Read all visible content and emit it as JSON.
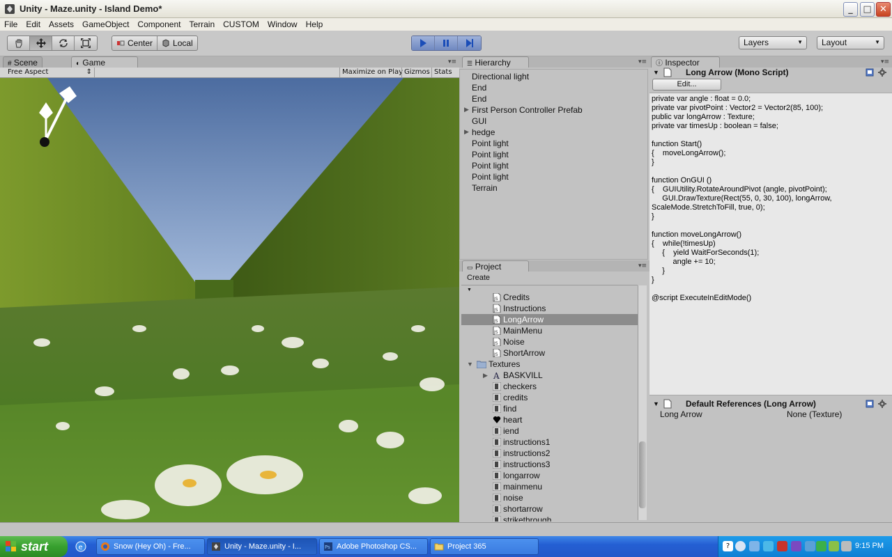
{
  "window": {
    "title": "Unity - Maze.unity - Island Demo*"
  },
  "menu": [
    "File",
    "Edit",
    "Assets",
    "GameObject",
    "Component",
    "Terrain",
    "CUSTOM",
    "Window",
    "Help"
  ],
  "toolbar": {
    "pivot_center": "Center",
    "pivot_local": "Local",
    "layers": "Layers",
    "layout": "Layout"
  },
  "game_view": {
    "tabs": [
      "Scene",
      "Game"
    ],
    "aspect": "Free Aspect",
    "maximize_on_play": "Maximize on Play",
    "gizmos": "Gizmos",
    "stats": "Stats"
  },
  "hierarchy": {
    "tab": "Hierarchy",
    "items": [
      {
        "label": "Directional light",
        "expandable": false
      },
      {
        "label": "End",
        "expandable": false
      },
      {
        "label": "End",
        "expandable": false
      },
      {
        "label": "First Person Controller Prefab",
        "expandable": true
      },
      {
        "label": "GUI",
        "expandable": false
      },
      {
        "label": "hedge",
        "expandable": true
      },
      {
        "label": "Point light",
        "expandable": false
      },
      {
        "label": "Point light",
        "expandable": false
      },
      {
        "label": "Point light",
        "expandable": false
      },
      {
        "label": "Point light",
        "expandable": false
      },
      {
        "label": "Terrain",
        "expandable": false
      }
    ]
  },
  "project": {
    "tab": "Project",
    "create": "Create",
    "items": [
      {
        "label": "Credits",
        "type": "script",
        "indent": 2
      },
      {
        "label": "Instructions",
        "type": "script",
        "indent": 2
      },
      {
        "label": "LongArrow",
        "type": "script",
        "indent": 2,
        "selected": true
      },
      {
        "label": "MainMenu",
        "type": "script",
        "indent": 2
      },
      {
        "label": "Noise",
        "type": "script",
        "indent": 2
      },
      {
        "label": "ShortArrow",
        "type": "script",
        "indent": 2
      },
      {
        "label": "Textures",
        "type": "folder",
        "indent": 1
      },
      {
        "label": "BASKVILL",
        "type": "font",
        "indent": 2
      },
      {
        "label": "checkers",
        "type": "texture",
        "indent": 2
      },
      {
        "label": "credits",
        "type": "texture",
        "indent": 2
      },
      {
        "label": "find",
        "type": "texture",
        "indent": 2
      },
      {
        "label": "heart",
        "type": "heart",
        "indent": 2
      },
      {
        "label": "iend",
        "type": "texture",
        "indent": 2
      },
      {
        "label": "instructions1",
        "type": "texture",
        "indent": 2
      },
      {
        "label": "instructions2",
        "type": "texture",
        "indent": 2
      },
      {
        "label": "instructions3",
        "type": "texture",
        "indent": 2
      },
      {
        "label": "longarrow",
        "type": "texture",
        "indent": 2
      },
      {
        "label": "mainmenu",
        "type": "texture",
        "indent": 2
      },
      {
        "label": "noise",
        "type": "texture",
        "indent": 2
      },
      {
        "label": "shortarrow",
        "type": "texture",
        "indent": 2
      },
      {
        "label": "strikethrough",
        "type": "texture",
        "indent": 2
      }
    ]
  },
  "inspector": {
    "tab": "Inspector",
    "component_title": "Long Arrow (Mono Script)",
    "edit_button": "Edit...",
    "code": [
      "private var angle : float = 0.0;",
      "private var pivotPoint : Vector2 = Vector2(85, 100);",
      "public var longArrow : Texture;",
      "private var timesUp : boolean = false;",
      "",
      "function Start()",
      "{    moveLongArrow();",
      "}",
      "",
      "function OnGUI ()",
      "{    GUIUtility.RotateAroundPivot (angle, pivotPoint);",
      "     GUI.DrawTexture(Rect(55, 0, 30, 100), longArrow,",
      "ScaleMode.StretchToFill, true, 0);",
      "}",
      "",
      "function moveLongArrow()",
      "{    while(!timesUp)",
      "     {    yield WaitForSeconds(1);",
      "          angle += 10;",
      "     }",
      "}",
      "",
      "@script ExecuteInEditMode()"
    ],
    "defaults_title": "Default References (Long Arrow)",
    "defaults_field": "Long Arrow",
    "defaults_value": "None (Texture)"
  },
  "taskbar": {
    "start": "start",
    "buttons": [
      {
        "label": "Snow (Hey Oh) - Fre...",
        "active": false
      },
      {
        "label": "Unity - Maze.unity - I...",
        "active": true
      },
      {
        "label": "Adobe Photoshop CS...",
        "active": false
      },
      {
        "label": "Project 365",
        "active": false
      }
    ],
    "clock": "9:15 PM"
  }
}
